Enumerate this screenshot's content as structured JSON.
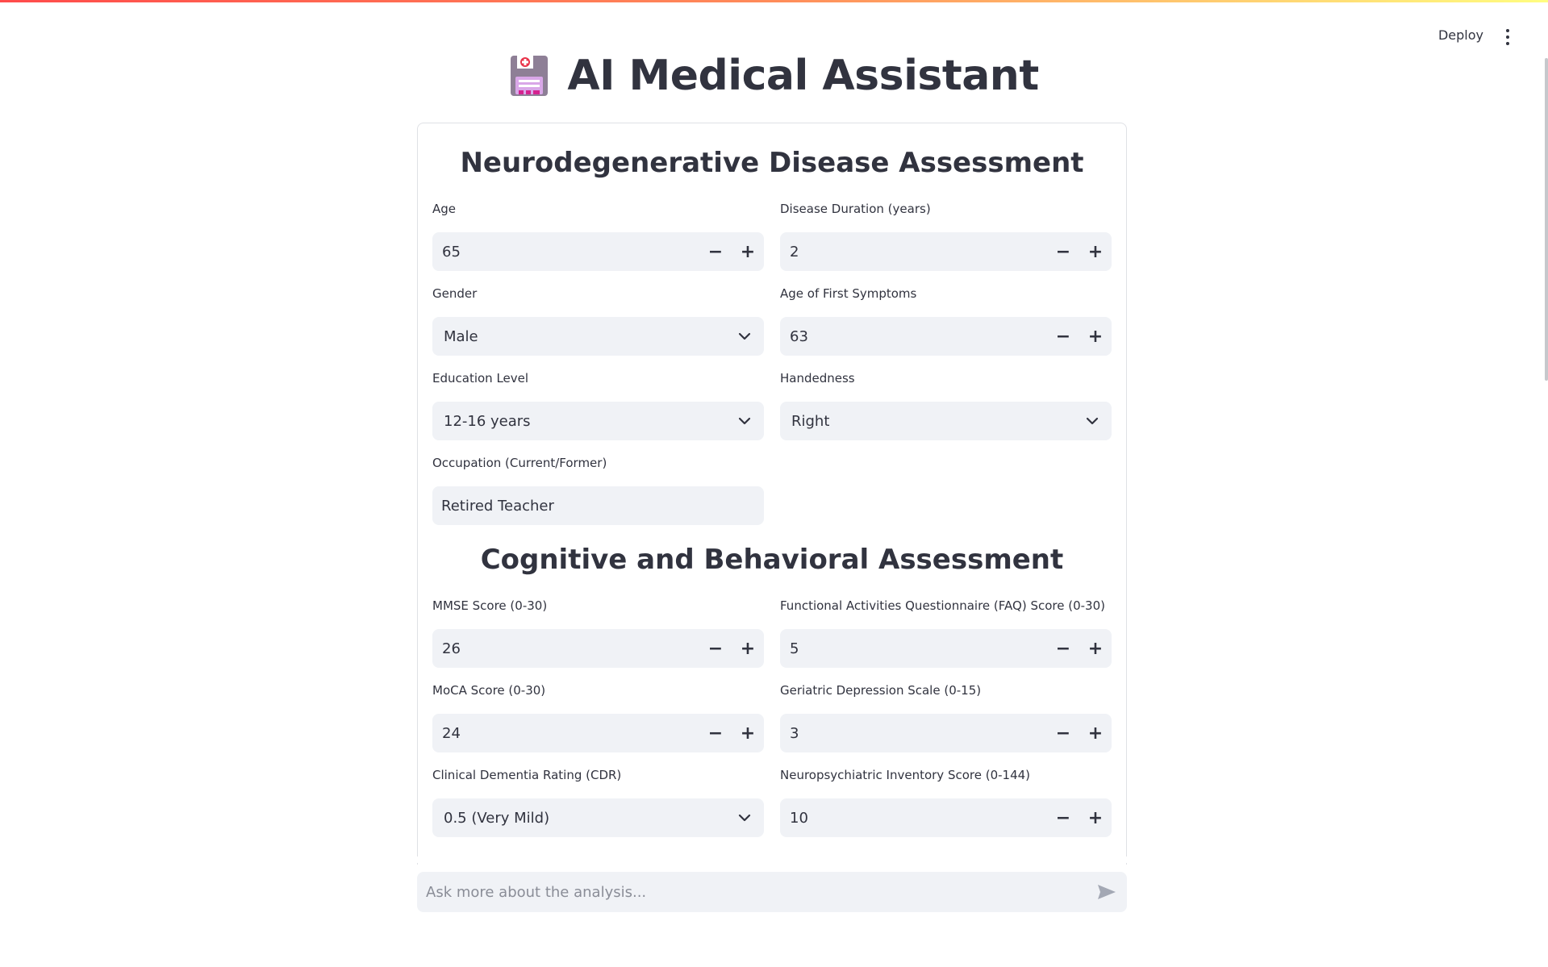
{
  "header": {
    "deploy_label": "Deploy"
  },
  "app": {
    "title": "AI Medical Assistant"
  },
  "sections": {
    "demographics_title": "Neurodegenerative Disease Assessment",
    "cognitive_title": "Cognitive and Behavioral Assessment"
  },
  "fields": {
    "age": {
      "label": "Age",
      "value": "65"
    },
    "disease_duration": {
      "label": "Disease Duration (years)",
      "value": "2"
    },
    "gender": {
      "label": "Gender",
      "value": "Male"
    },
    "age_first_symptoms": {
      "label": "Age of First Symptoms",
      "value": "63"
    },
    "education": {
      "label": "Education Level",
      "value": "12-16 years"
    },
    "handedness": {
      "label": "Handedness",
      "value": "Right"
    },
    "occupation": {
      "label": "Occupation (Current/Former)",
      "value": "Retired Teacher"
    },
    "mmse": {
      "label": "MMSE Score (0-30)",
      "value": "26"
    },
    "faq": {
      "label": "Functional Activities Questionnaire (FAQ) Score (0-30)",
      "value": "5"
    },
    "moca": {
      "label": "MoCA Score (0-30)",
      "value": "24"
    },
    "gds": {
      "label": "Geriatric Depression Scale (0-15)",
      "value": "3"
    },
    "cdr": {
      "label": "Clinical Dementia Rating (CDR)",
      "value": "0.5 (Very Mild)"
    },
    "npi": {
      "label": "Neuropsychiatric Inventory Score (0-144)",
      "value": "10"
    }
  },
  "stepper": {
    "minus": "−",
    "plus": "+"
  },
  "chat": {
    "placeholder": "Ask more about the analysis..."
  },
  "colors": {
    "accent_red": "#ff4b4b",
    "input_bg": "#f0f2f6",
    "text": "#31333f"
  }
}
